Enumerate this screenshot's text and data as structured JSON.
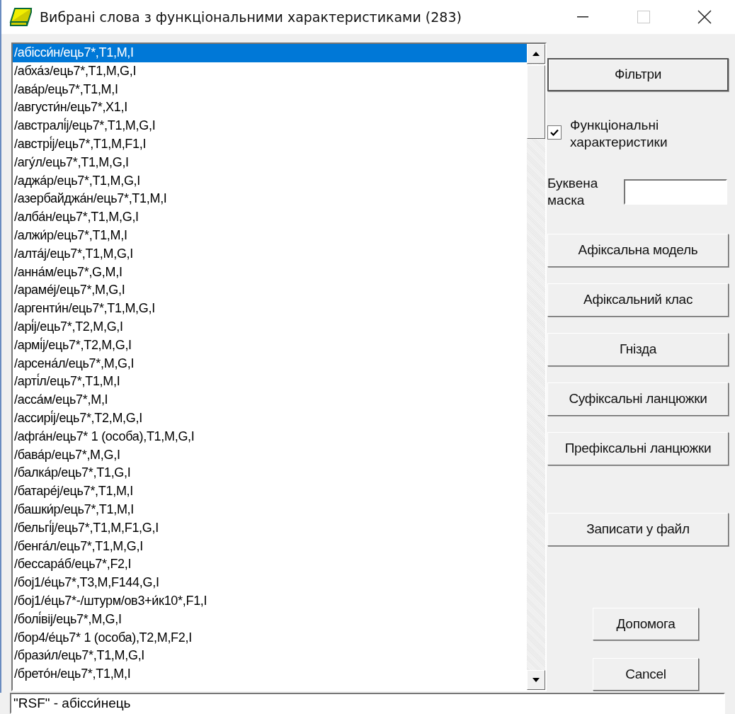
{
  "window": {
    "title": "Вибрані слова з функціональними характеристиками (283)",
    "maximize_disabled": true
  },
  "list": {
    "items": [
      {
        "text": "/абісси́н/ець7*,T1,M,I",
        "selected": true
      },
      {
        "text": "/абха́з/ець7*,T1,M,G,I",
        "selected": false
      },
      {
        "text": "/ава́р/ець7*,T1,M,I",
        "selected": false
      },
      {
        "text": "/августи́н/ець7*,X1,I",
        "selected": false
      },
      {
        "text": "/австралі́j/ець7*,T1,M,G,I",
        "selected": false
      },
      {
        "text": "/австрі́j/ець7*,T1,M,F1,I",
        "selected": false
      },
      {
        "text": "/агу́л/ець7*,T1,M,G,I",
        "selected": false
      },
      {
        "text": "/аджа́р/ець7*,T1,M,G,I",
        "selected": false
      },
      {
        "text": "/азербайджа́н/ець7*,T1,M,I",
        "selected": false
      },
      {
        "text": "/алба́н/ець7*,T1,M,G,I",
        "selected": false
      },
      {
        "text": "/алжи́р/ець7*,T1,M,I",
        "selected": false
      },
      {
        "text": "/алта́j/ець7*,T1,M,G,I",
        "selected": false
      },
      {
        "text": "/анна́м/ець7*,G,M,I",
        "selected": false
      },
      {
        "text": "/араме́j/ець7*,M,G,I",
        "selected": false
      },
      {
        "text": "/аргенти́н/ець7*,T1,M,G,I",
        "selected": false
      },
      {
        "text": "/арі́j/ець7*,T2,M,G,I",
        "selected": false
      },
      {
        "text": "/армі́j/ець7*,T2,M,G,I",
        "selected": false
      },
      {
        "text": "/арсена́л/ець7*,M,G,I",
        "selected": false
      },
      {
        "text": "/арті́л/ець7*,T1,M,I",
        "selected": false
      },
      {
        "text": "/асса́м/ець7*,M,I",
        "selected": false
      },
      {
        "text": "/ассирі́j/ець7*,T2,M,G,I",
        "selected": false
      },
      {
        "text": "/афга́н/ець7* 1 (особа),T1,M,G,I",
        "selected": false
      },
      {
        "text": "/бава́р/ець7*,M,G,I",
        "selected": false
      },
      {
        "text": "/балка́р/ець7*,T1,G,I",
        "selected": false
      },
      {
        "text": "/батаре́j/ець7*,T1,M,I",
        "selected": false
      },
      {
        "text": "/башки́р/ець7*,T1,M,I",
        "selected": false
      },
      {
        "text": "/бельгі́j/ець7*,T1,M,F1,G,I",
        "selected": false
      },
      {
        "text": "/бенга́л/ець7*,T1,M,G,I",
        "selected": false
      },
      {
        "text": "/бессара́б/ець7*,F2,I",
        "selected": false
      },
      {
        "text": "/боj1/е́ць7*,T3,M,F144,G,I",
        "selected": false
      },
      {
        "text": "/боj1/е́ць7*-/штурм/ов3+и́к10*,F1,I",
        "selected": false
      },
      {
        "text": "/болі́вij/ець7*,M,G,I",
        "selected": false
      },
      {
        "text": "/бор4/е́ць7* 1 (особа),T2,M,F2,I",
        "selected": false
      },
      {
        "text": "/брази́л/ець7*,T1,M,G,I",
        "selected": false
      },
      {
        "text": "/брето́н/ець7*,T1,M,I",
        "selected": false
      }
    ]
  },
  "filter_button": {
    "label": "Фільтри",
    "default": true
  },
  "checkbox": {
    "label": "Функціональні характеристики",
    "checked": true
  },
  "mask": {
    "label": "Буквена маска"
  },
  "action_buttons": [
    {
      "label": "Афіксальна модель"
    },
    {
      "label": "Афіксальний клас"
    },
    {
      "label": "Гнізда"
    },
    {
      "label": "Суфіксальні ланцюжки"
    },
    {
      "label": "Префіксальні ланцюжки"
    }
  ],
  "save_button": {
    "label": "Записати у файл"
  },
  "help_button": {
    "label": "Допомога"
  },
  "cancel_button": {
    "label": "Cancel"
  },
  "status_field": {
    "value": "\"RSF\" - абісси́нець"
  }
}
